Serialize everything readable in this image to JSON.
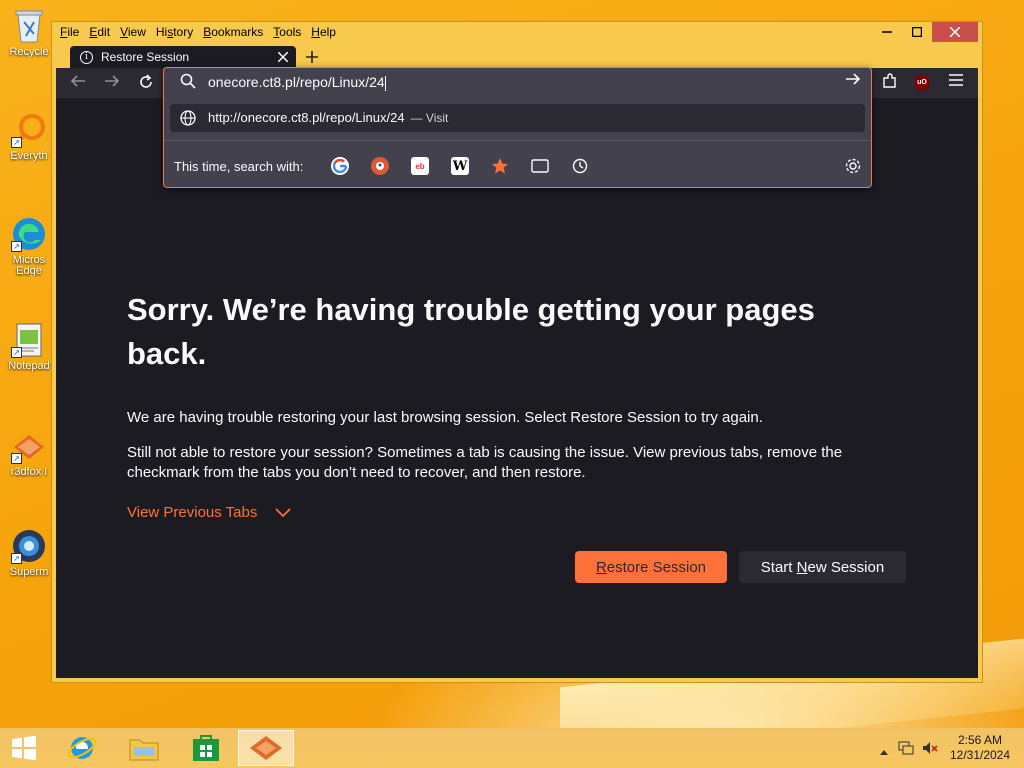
{
  "desktop": {
    "icons": [
      {
        "label": "Recycle",
        "icon": "recycle-bin-icon"
      },
      {
        "label": "Everyth",
        "icon": "everything-search-icon"
      },
      {
        "label": "Micros\nEdge",
        "line1": "Micros",
        "line2": "Edge",
        "icon": "edge-icon"
      },
      {
        "label": "Notepad",
        "icon": "notepad-icon"
      },
      {
        "label": "r3dfox I",
        "icon": "r3dfox-icon"
      },
      {
        "label": "Superm",
        "icon": "supermium-icon"
      }
    ]
  },
  "window": {
    "menu": [
      {
        "label": "File",
        "key": "F",
        "rest": "ile"
      },
      {
        "label": "Edit",
        "key": "E",
        "rest": "dit"
      },
      {
        "label": "View",
        "key": "V",
        "rest": "iew"
      },
      {
        "label": "History",
        "key": "s",
        "pre": "Hi",
        "rest": "tory"
      },
      {
        "label": "Bookmarks",
        "key": "B",
        "rest": "ookmarks"
      },
      {
        "label": "Tools",
        "key": "T",
        "rest": "ools"
      },
      {
        "label": "Help",
        "key": "H",
        "rest": "elp"
      }
    ],
    "tab": {
      "title": "Restore Session"
    },
    "urlbar": {
      "value": "onecore.ct8.pl/repo/Linux/24",
      "suggestion_url": "http://onecore.ct8.pl/repo/Linux/24",
      "suggestion_action": "— Visit",
      "search_with_label": "This time, search with:",
      "engines": [
        "google-icon",
        "duckduckgo-icon",
        "ebay-icon",
        "wikipedia-icon",
        "bookmarks-star-icon",
        "tabs-icon",
        "history-clock-icon"
      ]
    }
  },
  "page": {
    "title": "Sorry. We’re having trouble getting your pages back.",
    "para1": "We are having trouble restoring your last browsing session. Select Restore Session to try again.",
    "para2": "Still not able to restore your session? Sometimes a tab is causing the issue. View previous tabs, remove the checkmark from the tabs you don’t need to recover, and then restore.",
    "view_previous": "View Previous Tabs",
    "restore_button": {
      "key": "R",
      "rest": "estore Session",
      "label": "Restore Session"
    },
    "new_session_button": {
      "pre": "Start ",
      "key": "N",
      "rest": "ew Session",
      "label": "Start New Session"
    }
  },
  "taskbar": {
    "time": "2:56 AM",
    "date": "12/31/2024"
  },
  "colors": {
    "accent": "#ff7139",
    "page_bg": "#1c1b22",
    "panel_bg": "#42414d",
    "desktop": "#f6a80d"
  }
}
